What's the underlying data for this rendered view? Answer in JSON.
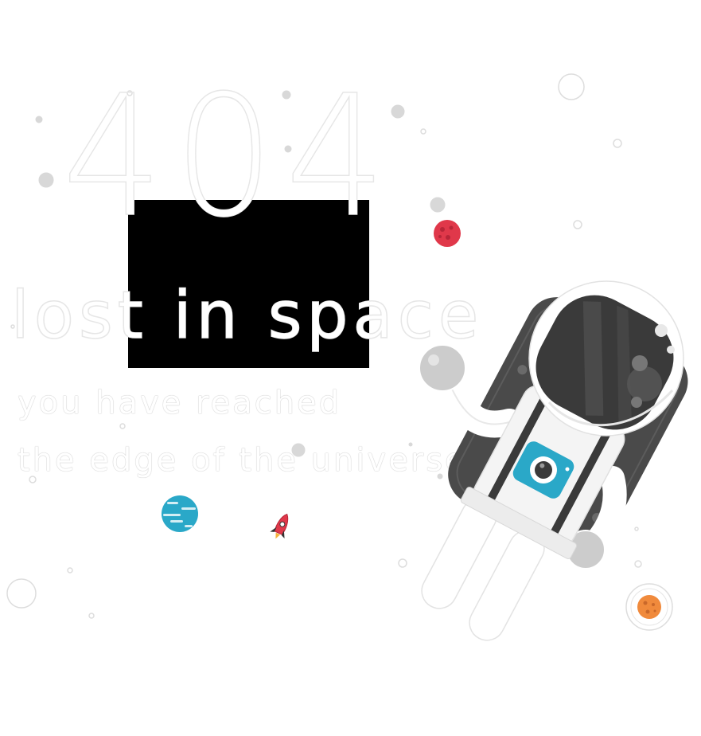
{
  "error": {
    "code": "404",
    "title": "lost in space",
    "subtitle_line1": "you have reached",
    "subtitle_line2": "the edge of the universe."
  },
  "colors": {
    "background": "#ffffff",
    "box": "#000000",
    "planet_red": "#e0384a",
    "planet_blue": "#2aa8c8",
    "planet_orange": "#f08a3c",
    "visor": "#3a3a3a",
    "accent_blue": "#2aa8c8"
  },
  "icons": [
    "astronaut-icon",
    "rocket-icon",
    "red-planet-icon",
    "blue-planet-icon",
    "orange-planet-icon",
    "star-icon"
  ]
}
